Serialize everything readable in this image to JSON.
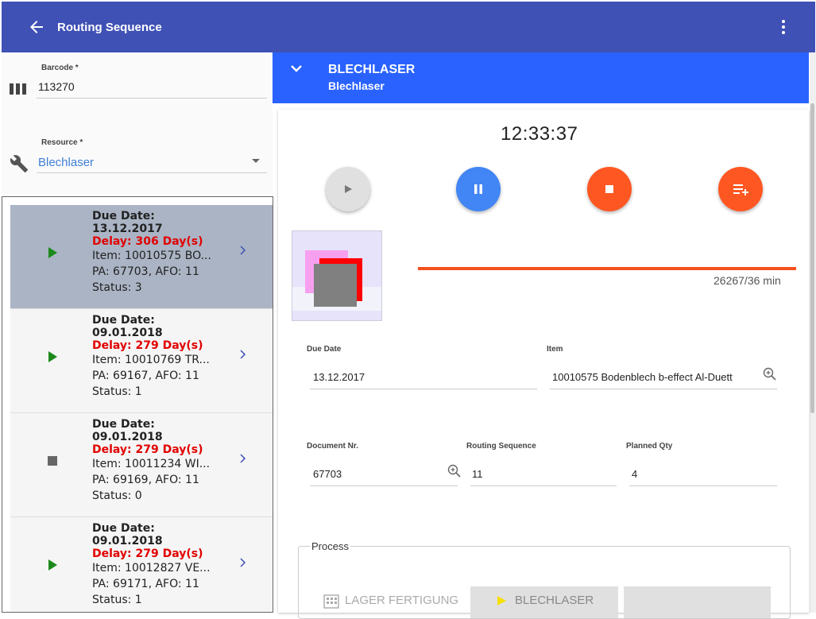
{
  "appbar": {
    "title": "Routing Sequence"
  },
  "left": {
    "barcode": {
      "label": "Barcode *",
      "value": "113270"
    },
    "resource": {
      "label": "Resource *",
      "value": "Blechlaser"
    },
    "items": [
      {
        "due_label": "Due Date:",
        "due": "13.12.2017",
        "delay": "Delay: 306 Day(s)",
        "item": "Item: 10010575 BO...",
        "pa": "PA: 67703, AFO: 11",
        "status": "Status: 3",
        "state": "play"
      },
      {
        "due_label": "Due Date:",
        "due": "09.01.2018",
        "delay": "Delay: 279 Day(s)",
        "item": "Item: 10010769 TR...",
        "pa": "PA: 69167, AFO: 11",
        "status": "Status: 1",
        "state": "play"
      },
      {
        "due_label": "Due Date:",
        "due": "09.01.2018",
        "delay": "Delay: 279 Day(s)",
        "item": "Item: 10011234 WI...",
        "pa": "PA: 69169, AFO: 11",
        "status": "Status: 0",
        "state": "stop"
      },
      {
        "due_label": "Due Date:",
        "due": "09.01.2018",
        "delay": "Delay: 279 Day(s)",
        "item": "Item: 10012827 VE...",
        "pa": "PA: 69171, AFO: 11",
        "status": "Status: 1",
        "state": "play"
      }
    ]
  },
  "right": {
    "header": {
      "title": "BLECHLASER",
      "subtitle": "Blechlaser"
    },
    "timer": "12:33:37",
    "progress": {
      "text": "26267/36 min",
      "fraction": 1.0
    },
    "fields": {
      "due_date": {
        "label": "Due Date",
        "value": "13.12.2017"
      },
      "item": {
        "label": "Item",
        "value": "10010575 Bodenblech b-effect Al-Duett"
      },
      "document": {
        "label": "Document Nr.",
        "value": "67703"
      },
      "routing_seq": {
        "label": "Routing Sequence",
        "value": "11"
      },
      "planned_qty": {
        "label": "Planned Qty",
        "value": "4"
      }
    },
    "process": {
      "title": "Process",
      "steps": [
        {
          "label": "LAGER FERTIGUNG"
        },
        {
          "label": "BLECHLASER"
        },
        {
          "label": ""
        }
      ]
    }
  },
  "colors": {
    "appbar": "#3f51b5",
    "header": "#2962ff",
    "accent_orange": "#ff5722",
    "pause_blue": "#4285f4",
    "delay_red": "#e10000",
    "play_green": "#1b8a1b"
  }
}
